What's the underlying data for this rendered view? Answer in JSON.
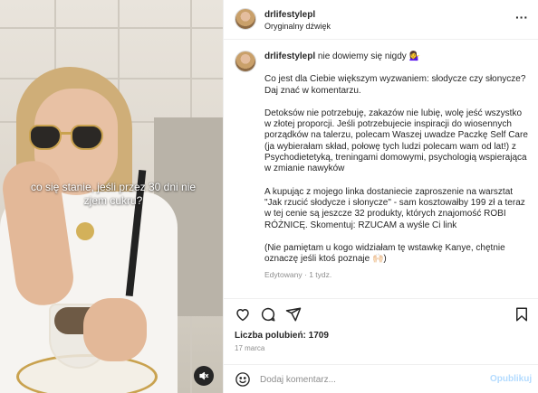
{
  "media": {
    "caption": "co się stanie, jeśli przez 30 dni nie zjem cukru?",
    "mute_icon": "speaker-muted-icon"
  },
  "header": {
    "username": "drlifestylepl",
    "audio": "Oryginalny dźwięk",
    "more_icon": "more-horizontal-icon",
    "more_glyph": "···"
  },
  "post": {
    "username": "drlifestylepl",
    "headline": "nie dowiemy się nigdy 💁‍♀️",
    "paragraphs": [
      "Co jest dla Ciebie większym wyzwaniem: słodycze czy słonycze? Daj znać w komentarzu.",
      "Detoksów nie potrzebuję, zakazów nie lubię, wolę jeść wszystko w złotej proporcji. Jeśli potrzebujecie inspiracji do wiosennych porządków na talerzu, polecam Waszej uwadze Paczkę Self Care (ja wybierałam skład, połowę tych ludzi polecam wam od lat!) z Psychodietetyką, treningami domowymi, psychologią wspierająca w zmianie nawyków",
      "A kupując z mojego linka dostaniecie zaproszenie na warsztat \"Jak rzucić słodycze i słonycze\" - sam kosztowałby 199 zł a teraz w tej cenie są jeszcze 32 produkty, których znajomość ROBI RÓŻNICĘ. Skomentuj: RZUCAM a wyśle Ci link",
      "(Nie pamiętam u kogo widziałam tę wstawkę Kanye, chętnie oznaczę jeśli ktoś poznaje 🙌🏻)"
    ],
    "edited": "Edytowany",
    "separator": "·",
    "time": "1 tydz."
  },
  "actions": {
    "like_icon": "heart-icon",
    "comment_icon": "comment-icon",
    "share_icon": "send-icon",
    "save_icon": "bookmark-icon"
  },
  "likes": "Liczba polubień: 1709",
  "date": "17 marca",
  "comment_box": {
    "emoji_icon": "emoji-icon",
    "placeholder": "Dodaj komentarz...",
    "publish": "Opublikuj"
  }
}
